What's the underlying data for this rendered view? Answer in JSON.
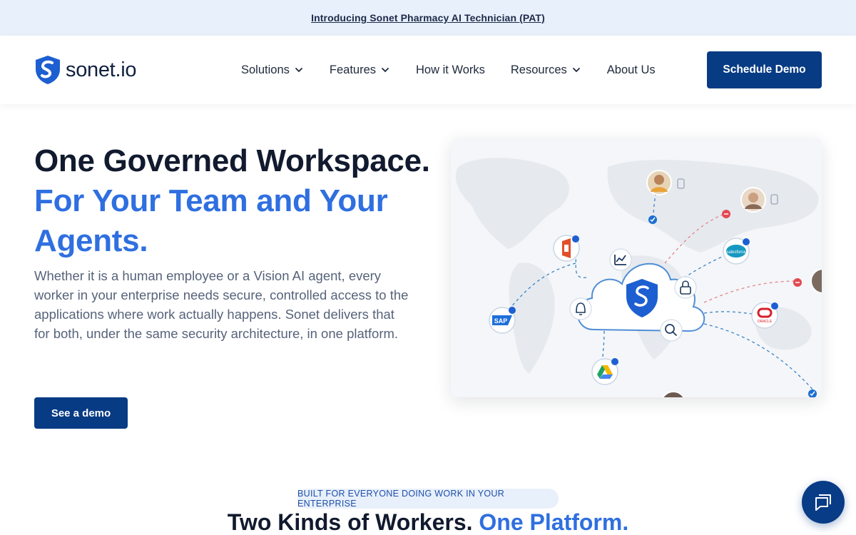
{
  "announcement": {
    "text": "Introducing Sonet Pharmacy AI Technician (PAT)"
  },
  "brand": {
    "name": "sonet.io",
    "logo_icon": "shield-s-logo"
  },
  "nav": {
    "items": [
      {
        "label": "Solutions",
        "has_dropdown": true
      },
      {
        "label": "Features",
        "has_dropdown": true
      },
      {
        "label": "How it Works",
        "has_dropdown": false
      },
      {
        "label": "Resources",
        "has_dropdown": true
      },
      {
        "label": "About Us",
        "has_dropdown": false
      }
    ],
    "cta": "Schedule Demo"
  },
  "hero": {
    "title_line1": "One Governed Workspace.",
    "title_line2": "For Your Team and Your",
    "title_line3": "Agents.",
    "description": "Whether it is a human employee or a Vision AI agent, every worker in your enterprise needs secure, controlled access to the applications where work actually happens. Sonet delivers that for both, under the same security architecture, in one platform.",
    "cta": "See a demo"
  },
  "illustration": {
    "app_labels": {
      "sap": "SAP",
      "salesforce": "salesforce",
      "oracle": "ORACLE"
    },
    "icons": [
      "office-icon",
      "sap-icon",
      "google-drive-icon",
      "salesforce-icon",
      "oracle-icon",
      "chart-icon",
      "bell-icon",
      "lock-icon",
      "search-icon"
    ]
  },
  "section": {
    "eyebrow": "BUILT FOR EVERYONE DOING WORK IN YOUR ENTERPRISE",
    "title_part1": "Two Kinds of Workers.",
    "title_part2": "One Platform."
  },
  "colors": {
    "primary": "#073b84",
    "accent": "#2f6fe0",
    "banner": "#e8f0fb"
  }
}
